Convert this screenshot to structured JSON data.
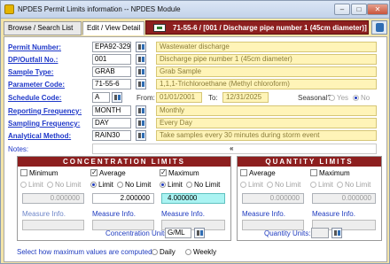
{
  "window": {
    "title": "NPDES Permit Limits information -- NPDES Module",
    "buttons": {
      "minimize": "–",
      "maximize": "□",
      "close": "✕"
    }
  },
  "tabs": [
    {
      "label": "Browse / Search List"
    },
    {
      "label": "Edit / View Detail",
      "active": true
    }
  ],
  "record_header": "71-55-6 /  [001 / Discharge pipe number 1 (45cm diameter)]",
  "fields": {
    "permit_number": {
      "label": "Permit Number:",
      "code": "EPA92-329",
      "desc": "Wastewater discharge"
    },
    "dp_outfall": {
      "label": "DP/Outfall No.:",
      "code": "001",
      "desc": "Discharge pipe number 1 (45cm diameter)"
    },
    "sample_type": {
      "label": "Sample Type:",
      "code": "GRAB",
      "desc": "Grab Sample"
    },
    "parameter_code": {
      "label": "Parameter Code:",
      "code": "71-55-6",
      "desc": "1,1,1-Trichloroethane  (Methyl chloroform)"
    },
    "schedule_code": {
      "label": "Schedule Code:",
      "code": "A",
      "from_label": "From:",
      "from": "01/01/2001",
      "to_label": "To:",
      "to": "12/31/2025",
      "seasonal_label": "Seasonal?",
      "yes": "Yes",
      "no": "No",
      "seasonal_value": "No"
    },
    "reporting_frequency": {
      "label": "Reporting Frequency:",
      "code": "MONTH",
      "desc": "Monthly"
    },
    "sampling_frequency": {
      "label": "Sampling Frequency:",
      "code": "DAY",
      "desc": "Every Day"
    },
    "analytical_method": {
      "label": "Analytical Method:",
      "code": "RAIN30",
      "desc": "Take samples every 30 minutes during storm event"
    },
    "notes": {
      "label": "Notes:",
      "cursor": "«"
    }
  },
  "concentration": {
    "title": "CONCENTRATION LIMITS",
    "columns": [
      {
        "name": "Minimum",
        "checked": false,
        "limit": "Limit",
        "no_limit": "No Limit",
        "value": "0.000000",
        "measure": "Measure Info."
      },
      {
        "name": "Average",
        "checked": true,
        "limit": "Limit",
        "no_limit": "No Limit",
        "value": "2.000000",
        "measure": "Measure Info."
      },
      {
        "name": "Maximum",
        "checked": true,
        "limit": "Limit",
        "no_limit": "No Limit",
        "value": "4.000000",
        "measure": "Measure Info."
      }
    ],
    "units_label": "Concentration Units:",
    "units": "G/ML"
  },
  "quantity": {
    "title": "QUANTITY LIMITS",
    "columns": [
      {
        "name": "Average",
        "checked": false,
        "limit": "Limit",
        "no_limit": "No Limit",
        "value": "0.000000",
        "measure": "Measure Info."
      },
      {
        "name": "Maximum",
        "checked": false,
        "limit": "Limit",
        "no_limit": "No Limit",
        "value": "0.000000",
        "measure": "Measure Info."
      }
    ],
    "units_label": "Quantity Units:"
  },
  "footer": {
    "prompt": "Select how maximum values are computed:",
    "daily": "Daily",
    "weekly": "Weekly"
  }
}
